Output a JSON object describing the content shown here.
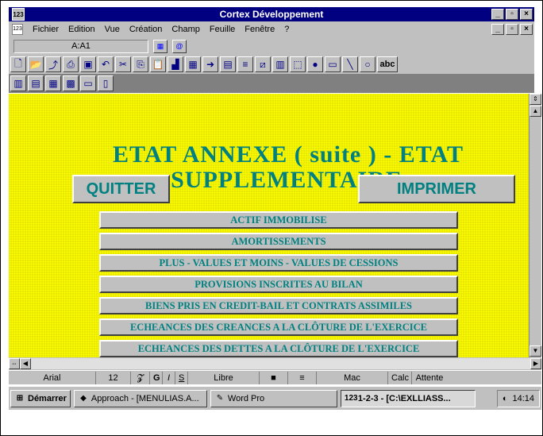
{
  "window": {
    "title": "Cortex Développement",
    "min_label": "_",
    "max_label": "▫",
    "close_label": "×"
  },
  "menubar": {
    "items": [
      "Fichier",
      "Edition",
      "Vue",
      "Création",
      "Champ",
      "Feuille",
      "Fenêtre",
      "?"
    ]
  },
  "cell_reference": "A:A1",
  "sheet": {
    "heading_line1": "ETAT ANNEXE ( suite ) - ETAT",
    "heading_line2": "SUPPLEMENTAIRE",
    "quit_label": "QUITTER",
    "print_label": "IMPRIMER",
    "menu_items": [
      "ACTIF IMMOBILISE",
      "AMORTISSEMENTS",
      "PLUS - VALUES ET MOINS - VALUES DE CESSIONS",
      "PROVISIONS INSCRITES AU BILAN",
      "BIENS PRIS EN CREDIT-BAIL ET CONTRATS ASSIMILES",
      "ECHEANCES DES CREANCES A LA CLÔTURE DE L'EXERCICE",
      "ECHEANCES DES DETTES A LA CLÔTURE DE L'EXERCICE"
    ]
  },
  "statusbar": {
    "font": "Arial",
    "size": "12",
    "style": "Libre",
    "mode": "Mac",
    "calc": "Calc",
    "status": "Attente"
  },
  "taskbar": {
    "start": "Démarrer",
    "tasks": [
      "Approach - [MENULIAS.A...",
      "Word Pro",
      "1-2-3 - [C:\\EXLLIASS..."
    ],
    "clock": "14:14"
  },
  "colors": {
    "titlebar": "#000080",
    "sheet_bg": "#ffff00",
    "accent_text": "#008080",
    "chrome": "#c0c0c0"
  }
}
